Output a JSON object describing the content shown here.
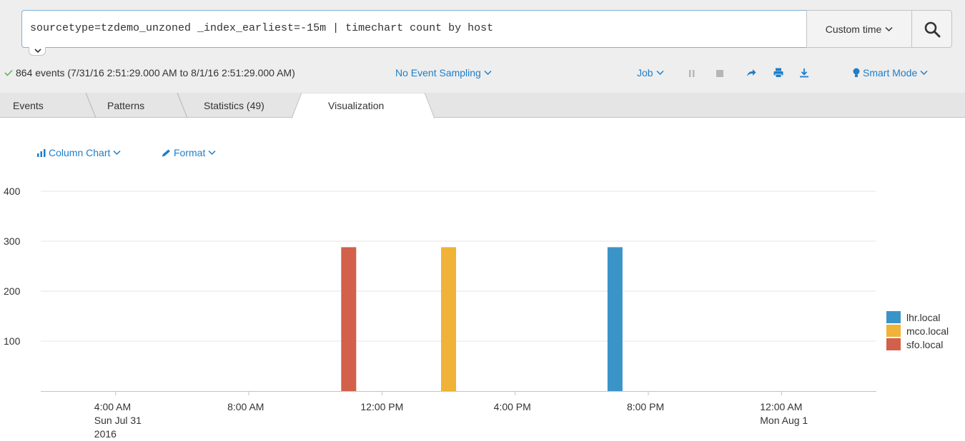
{
  "search": {
    "query": "sourcetype=tzdemo_unzoned _index_earliest=-15m | timechart count by host",
    "time_picker_label": "Custom time"
  },
  "status": {
    "events_summary": "864 events (7/31/16 2:51:29.000 AM to 8/1/16 2:51:29.000 AM)",
    "sampling_label": "No Event Sampling",
    "job_label": "Job",
    "mode_label": "Smart Mode"
  },
  "tabs": [
    {
      "label": "Events",
      "active": false
    },
    {
      "label": "Patterns",
      "active": false
    },
    {
      "label": "Statistics (49)",
      "active": false
    },
    {
      "label": "Visualization",
      "active": true
    }
  ],
  "viz": {
    "chart_type_label": "Column Chart",
    "format_label": "Format"
  },
  "colors": {
    "accent": "#1e7ec8",
    "success": "#5cb85c",
    "lhr": "#3b94c8",
    "mco": "#f0b237",
    "sfo": "#d2604a"
  },
  "chart_data": {
    "type": "bar",
    "title": "",
    "xlabel": "",
    "ylabel": "",
    "ylim": [
      0,
      400
    ],
    "y_ticks": [
      100,
      200,
      300,
      400
    ],
    "x_range": [
      "2016-07-31T01:45",
      "2016-08-01T02:51"
    ],
    "x_ticks": [
      {
        "time": "2016-07-31T04:00",
        "lines": [
          "4:00 AM",
          "Sun Jul 31",
          "2016"
        ]
      },
      {
        "time": "2016-07-31T08:00",
        "lines": [
          "8:00 AM"
        ]
      },
      {
        "time": "2016-07-31T12:00",
        "lines": [
          "12:00 PM"
        ]
      },
      {
        "time": "2016-07-31T16:00",
        "lines": [
          "4:00 PM"
        ]
      },
      {
        "time": "2016-07-31T20:00",
        "lines": [
          "8:00 PM"
        ]
      },
      {
        "time": "2016-08-01T00:00",
        "lines": [
          "12:00 AM",
          "Mon Aug 1"
        ]
      }
    ],
    "series": [
      {
        "name": "lhr.local",
        "color": "#3b94c8",
        "points": [
          {
            "time": "2016-07-31T19:00",
            "value": 288
          }
        ]
      },
      {
        "name": "mco.local",
        "color": "#f0b237",
        "points": [
          {
            "time": "2016-07-31T14:00",
            "value": 288
          }
        ]
      },
      {
        "name": "sfo.local",
        "color": "#d2604a",
        "points": [
          {
            "time": "2016-07-31T11:00",
            "value": 288
          }
        ]
      }
    ],
    "legend_position": "right",
    "grid": true
  }
}
